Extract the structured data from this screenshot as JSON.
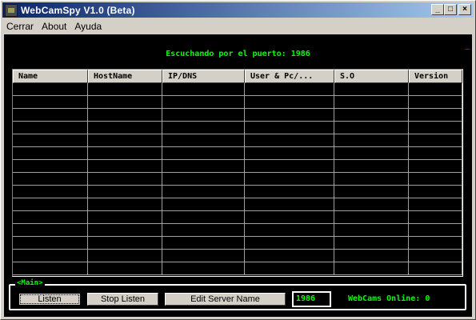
{
  "window": {
    "title": "WebCamSpy V1.0 (Beta)",
    "minimize_glyph": "_",
    "maximize_glyph": "□",
    "close_glyph": "×"
  },
  "menu": {
    "items": [
      "Cerrar",
      "About",
      "Ayuda"
    ]
  },
  "status": {
    "listening": "Escuchando por el puerto: 1986",
    "corner_mark": "_"
  },
  "table": {
    "columns": [
      "Name",
      "HostName",
      "IP/DNS",
      "User & Pc/...",
      "S.O",
      "Version"
    ],
    "row_count": 15
  },
  "main": {
    "legend": "<Main>",
    "listen_label": "Listen",
    "stop_label": "Stop Listen",
    "edit_label": "Edit Server Name",
    "port_value": "1986",
    "online_text": "WebCams Online: 0"
  },
  "colors": {
    "background": "#000000",
    "accent_green": "#00ff00",
    "title_gradient_start": "#0a246a",
    "title_gradient_end": "#a6caf0",
    "face": "#d4d0c8"
  },
  "icons": {
    "app": "webcam-icon"
  }
}
